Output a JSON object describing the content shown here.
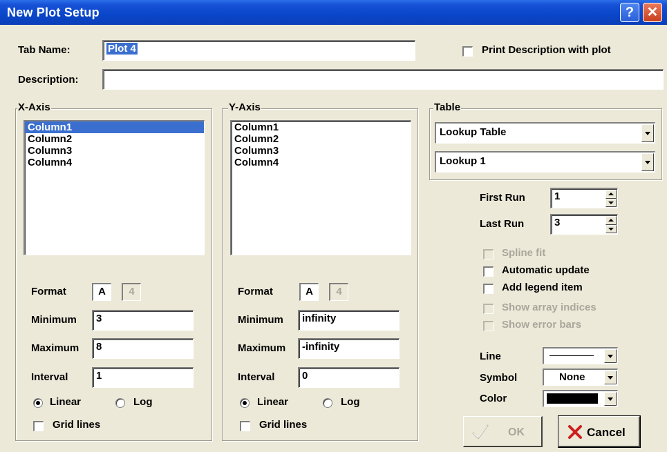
{
  "window": {
    "title": "New Plot Setup",
    "help_glyph": "?",
    "close_glyph": "✕"
  },
  "header": {
    "tab_name_label": "Tab Name:",
    "tab_name_value": "Plot 4",
    "print_desc_label": "Print Description with plot",
    "description_label": "Description:",
    "description_value": ""
  },
  "x_axis": {
    "group_title": "X-Axis",
    "columns": [
      "Column1",
      "Column2",
      "Column3",
      "Column4"
    ],
    "selected_index": 0,
    "format_label": "Format",
    "format_a": "A",
    "format_digits": "4",
    "minimum_label": "Minimum",
    "minimum_value": "3",
    "maximum_label": "Maximum",
    "maximum_value": "8",
    "interval_label": "Interval",
    "interval_value": "1",
    "linear_label": "Linear",
    "log_label": "Log",
    "scale_selected": "Linear",
    "grid_label": "Grid lines"
  },
  "y_axis": {
    "group_title": "Y-Axis",
    "columns": [
      "Column1",
      "Column2",
      "Column3",
      "Column4"
    ],
    "format_label": "Format",
    "format_a": "A",
    "format_digits": "4",
    "minimum_label": "Minimum",
    "minimum_value": "infinity",
    "maximum_label": "Maximum",
    "maximum_value": "-infinity",
    "interval_label": "Interval",
    "interval_value": "0",
    "linear_label": "Linear",
    "log_label": "Log",
    "scale_selected": "Linear",
    "grid_label": "Grid lines"
  },
  "table": {
    "group_title": "Table",
    "type_value": "Lookup Table",
    "name_value": "Lookup 1"
  },
  "runs": {
    "first_label": "First Run",
    "first_value": "1",
    "last_label": "Last Run",
    "last_value": "3"
  },
  "options": {
    "spline_fit": "Spline fit",
    "automatic_update": "Automatic update",
    "add_legend_item": "Add legend item",
    "show_array_indices": "Show array indices",
    "show_error_bars": "Show error bars"
  },
  "style": {
    "line_label": "Line",
    "symbol_label": "Symbol",
    "symbol_value": "None",
    "color_label": "Color",
    "color_value": "#000000"
  },
  "buttons": {
    "ok_label": "OK",
    "cancel_label": "Cancel"
  },
  "colors": {
    "title_bar": "#0a46c9",
    "selection": "#3a6fd0",
    "cancel_icon": "#cc1f1f",
    "disabled_text": "#a9a79b"
  }
}
